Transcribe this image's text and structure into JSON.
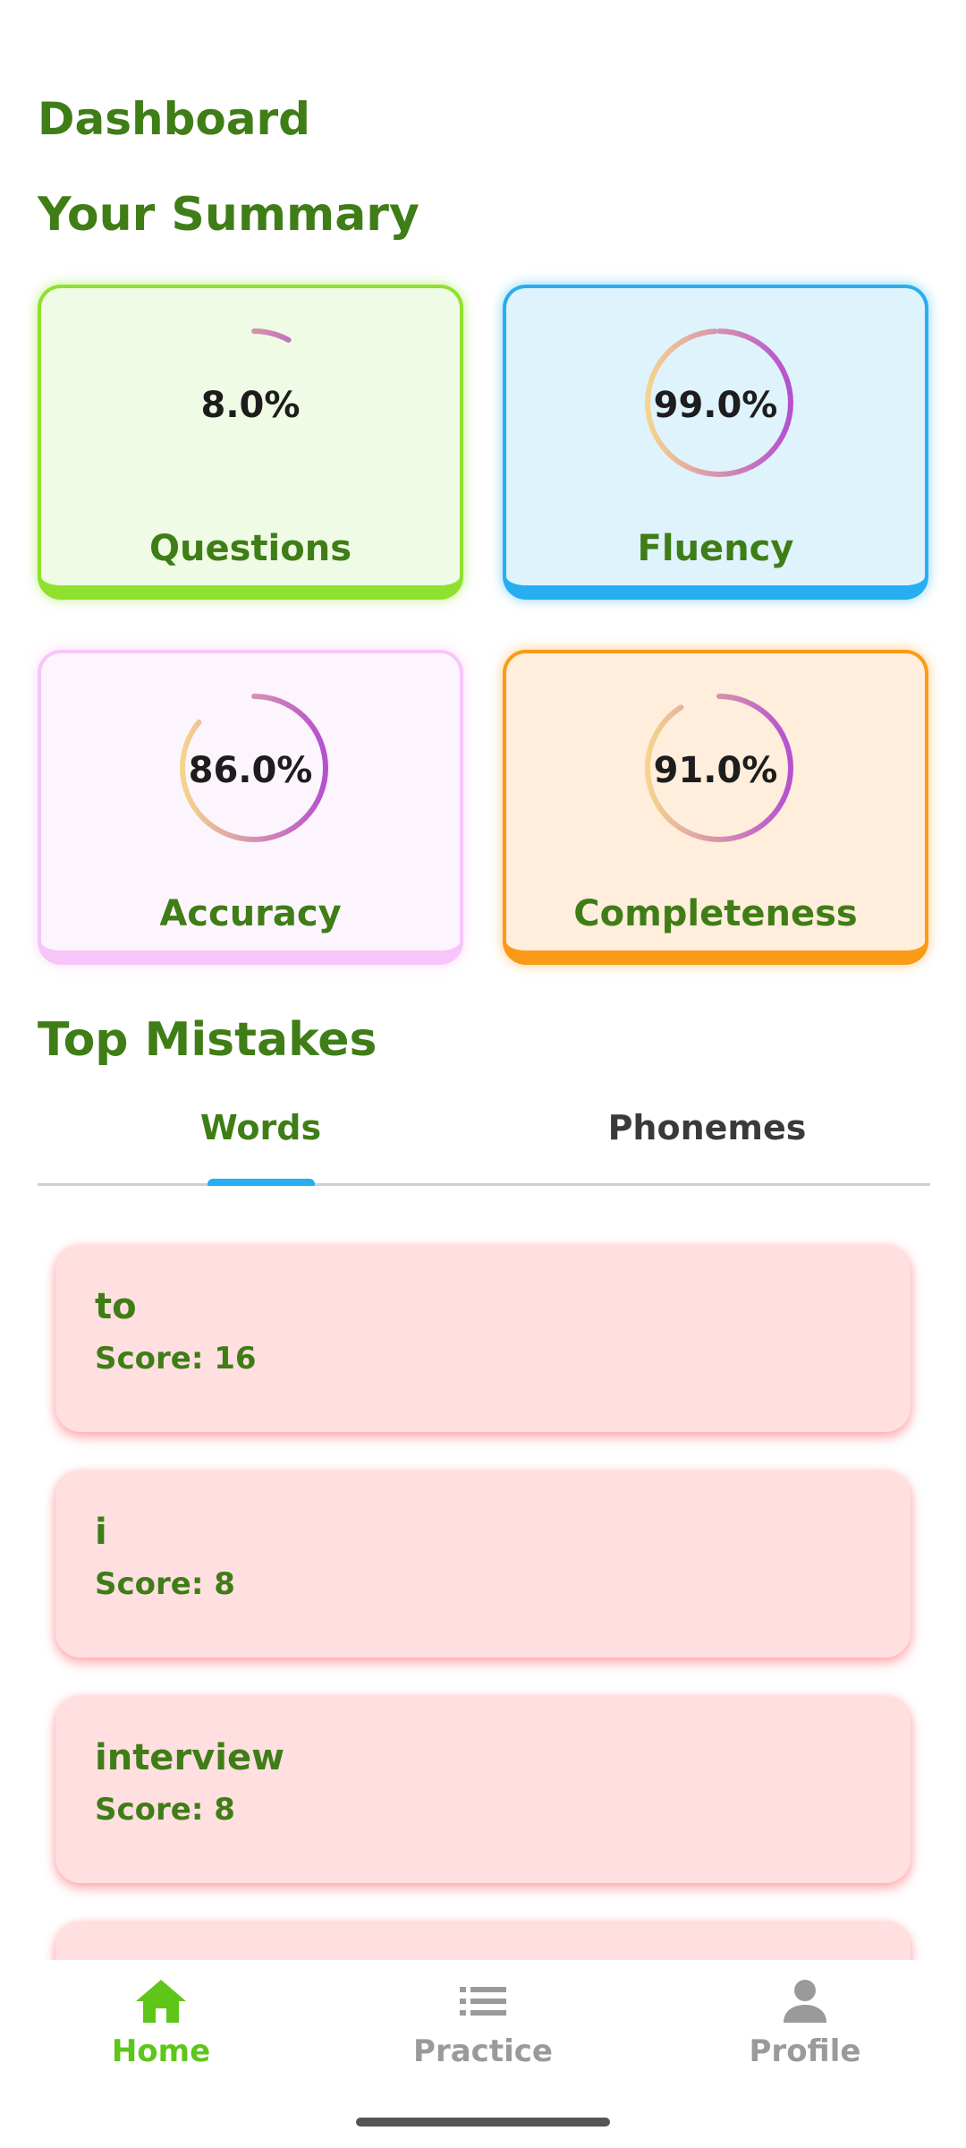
{
  "header": {
    "title": "Dashboard",
    "summary_title": "Your Summary"
  },
  "summary": {
    "cards": [
      {
        "label": "Questions",
        "percent_text": "8.0%",
        "value": 8.0
      },
      {
        "label": "Fluency",
        "percent_text": "99.0%",
        "value": 99.0
      },
      {
        "label": "Accuracy",
        "percent_text": "86.0%",
        "value": 86.0
      },
      {
        "label": "Completeness",
        "percent_text": "91.0%",
        "value": 91.0
      }
    ]
  },
  "mistakes": {
    "title": "Top Mistakes",
    "tabs": [
      {
        "label": "Words",
        "selected": true
      },
      {
        "label": "Phonemes",
        "selected": false
      }
    ],
    "items": [
      {
        "word": "to",
        "score": "Score: 16"
      },
      {
        "word": "i",
        "score": "Score: 8"
      },
      {
        "word": "interview",
        "score": "Score: 8"
      }
    ]
  },
  "nav": {
    "items": [
      {
        "label": "Home",
        "icon": "home-icon",
        "active": true
      },
      {
        "label": "Practice",
        "icon": "list-icon",
        "active": false
      },
      {
        "label": "Profile",
        "icon": "person-icon",
        "active": false
      }
    ]
  },
  "colors": {
    "primary_text": "#3f7d17",
    "active_nav": "#5ec619",
    "tab_indicator": "#27aef0",
    "ring_start": "#f6d48d",
    "ring_end": "#b54fd0"
  }
}
